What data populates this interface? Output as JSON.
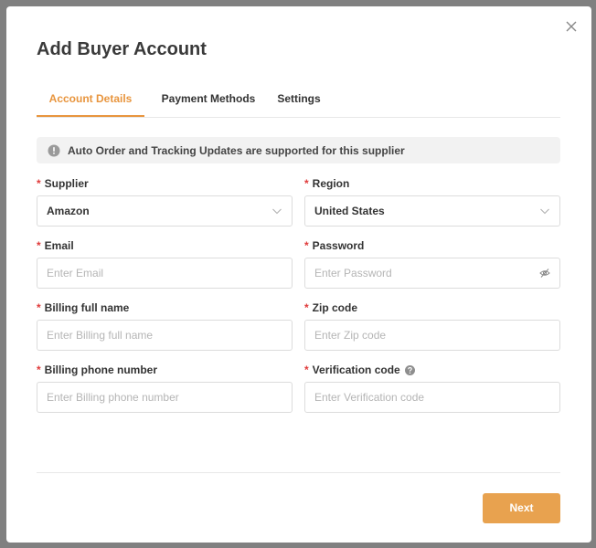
{
  "modal": {
    "title": "Add Buyer Account"
  },
  "tabs": [
    {
      "label": "Account Details",
      "active": true
    },
    {
      "label": "Payment Methods",
      "active": false
    },
    {
      "label": "Settings",
      "active": false
    }
  ],
  "notice": {
    "text": "Auto Order and Tracking Updates are supported for this supplier"
  },
  "form": {
    "required_marker": "*",
    "supplier": {
      "label": "Supplier",
      "value": "Amazon"
    },
    "region": {
      "label": "Region",
      "value": "United States"
    },
    "email": {
      "label": "Email",
      "placeholder": "Enter Email"
    },
    "password": {
      "label": "Password",
      "placeholder": "Enter Password"
    },
    "billing_name": {
      "label": "Billing full name",
      "placeholder": "Enter Billing full name"
    },
    "zip": {
      "label": "Zip code",
      "placeholder": "Enter Zip code"
    },
    "billing_phone": {
      "label": "Billing phone number",
      "placeholder": "Enter Billing phone number"
    },
    "verification": {
      "label": "Verification code",
      "placeholder": "Enter Verification code"
    }
  },
  "footer": {
    "next_label": "Next"
  },
  "colors": {
    "accent": "#e8953e",
    "button": "#e8a24f",
    "required": "#e03b3b"
  },
  "icons": {
    "close": "close-icon",
    "notice": "info-circle-icon",
    "select": "chevron-down-icon",
    "password_toggle": "eye-slash-icon",
    "help": "question-circle-icon"
  }
}
